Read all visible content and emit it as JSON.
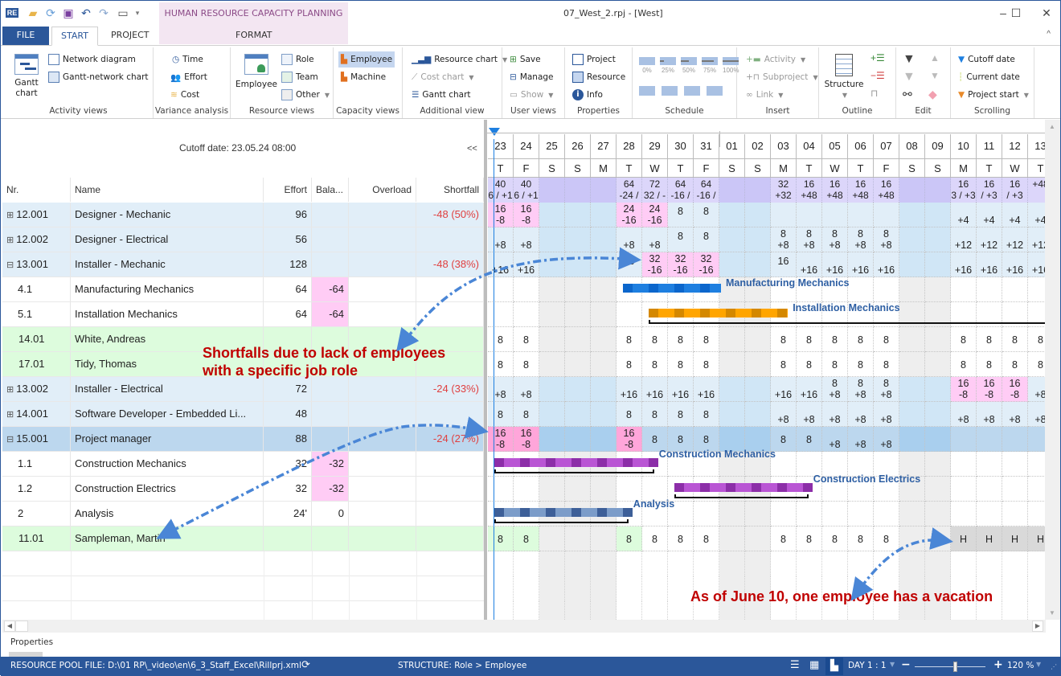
{
  "window": {
    "context_tab_group": "HUMAN RESOURCE CAPACITY PLANNING",
    "doc_title": "07_West_2.rpj - [West]",
    "controls": {
      "minimize": "–",
      "maximize": "☐",
      "close": "✕"
    }
  },
  "quick_access": [
    "app-logo",
    "open-folder",
    "refresh",
    "save",
    "undo",
    "redo",
    "window-layout",
    "customize"
  ],
  "tabs": [
    {
      "label": "FILE"
    },
    {
      "label": "START",
      "active": true
    },
    {
      "label": "PROJECT"
    },
    {
      "label": "FORMAT"
    }
  ],
  "ribbon": {
    "activity_views": {
      "label": "Activity views",
      "gantt": "Gantt chart",
      "gantt_l1": "Gantt",
      "gantt_l2": "chart",
      "network": "Network diagram",
      "gantt_network": "Gantt-network chart"
    },
    "variance": {
      "label": "Variance analysis",
      "time": "Time",
      "effort": "Effort",
      "cost": "Cost"
    },
    "resource_views": {
      "label": "Resource views",
      "employee": "Employee",
      "role": "Role",
      "team": "Team",
      "other": "Other"
    },
    "capacity_views": {
      "label": "Capacity views",
      "employee": "Employee",
      "machine": "Machine"
    },
    "additional": {
      "label": "Additional view",
      "resource_chart": "Resource chart",
      "cost_chart": "Cost chart",
      "gantt_chart": "Gantt chart"
    },
    "user_views": {
      "label": "User views",
      "save": "Save",
      "manage": "Manage",
      "show": "Show"
    },
    "properties": {
      "label": "Properties",
      "project": "Project",
      "resource": "Resource",
      "info": "Info"
    },
    "schedule": {
      "label": "Schedule",
      "pcts": [
        "0%",
        "25%",
        "50%",
        "75%",
        "100%"
      ]
    },
    "insert": {
      "label": "Insert",
      "activity": "Activity",
      "subproject": "Subproject",
      "link": "Link"
    },
    "outline": {
      "label": "Outline",
      "structure": "Structure"
    },
    "edit": {
      "label": "Edit"
    },
    "scrolling": {
      "label": "Scrolling",
      "cutoff": "Cutoff date",
      "current": "Current date",
      "project_start": "Project start"
    }
  },
  "table": {
    "cutoff_text": "Cutoff date: 23.05.24 08:00",
    "collapse_label": "<<",
    "columns": [
      "Nr.",
      "Name",
      "Effort",
      "Bala...",
      "Overload",
      "Shortfall"
    ],
    "rows": [
      {
        "nr": "12.001",
        "expander": "⊞",
        "name": "Designer - Mechanic",
        "effort": "96",
        "balance": "",
        "overload": "",
        "shortfall": "-48 (50%)",
        "type": "role"
      },
      {
        "nr": "12.002",
        "expander": "⊞",
        "name": "Designer - Electrical",
        "effort": "56",
        "balance": "",
        "overload": "",
        "shortfall": "",
        "type": "role"
      },
      {
        "nr": "13.001",
        "expander": "⊟",
        "name": "Installer - Mechanic",
        "effort": "128",
        "balance": "",
        "overload": "",
        "shortfall": "-48 (38%)",
        "type": "role"
      },
      {
        "nr": "4.1",
        "expander": "",
        "name": "Manufacturing Mechanics",
        "effort": "64",
        "balance": "-64",
        "overload": "",
        "shortfall": "",
        "type": "activity"
      },
      {
        "nr": "5.1",
        "expander": "",
        "name": "Installation Mechanics",
        "effort": "64",
        "balance": "-64",
        "overload": "",
        "shortfall": "",
        "type": "activity"
      },
      {
        "nr": "14.01",
        "expander": "",
        "name": "White, Andreas",
        "effort": "",
        "balance": "",
        "overload": "",
        "shortfall": "",
        "type": "employee"
      },
      {
        "nr": "17.01",
        "expander": "",
        "name": "Tidy, Thomas",
        "effort": "",
        "balance": "",
        "overload": "",
        "shortfall": "",
        "type": "employee"
      },
      {
        "nr": "13.002",
        "expander": "⊞",
        "name": "Installer - Electrical",
        "effort": "72",
        "balance": "",
        "overload": "",
        "shortfall": "-24 (33%)",
        "type": "role"
      },
      {
        "nr": "14.001",
        "expander": "⊞",
        "name": "Software Developer - Embedded Li...",
        "effort": "48",
        "balance": "",
        "overload": "",
        "shortfall": "",
        "type": "role"
      },
      {
        "nr": "15.001",
        "expander": "⊟",
        "name": "Project manager",
        "effort": "88",
        "balance": "",
        "overload": "",
        "shortfall": "-24 (27%)",
        "type": "role-selected"
      },
      {
        "nr": "1.1",
        "expander": "",
        "name": "Construction Mechanics",
        "effort": "32",
        "balance": "-32",
        "overload": "",
        "shortfall": "",
        "type": "activity"
      },
      {
        "nr": "1.2",
        "expander": "",
        "name": "Construction Electrics",
        "effort": "32",
        "balance": "-32",
        "overload": "",
        "shortfall": "",
        "type": "activity"
      },
      {
        "nr": "2",
        "expander": "",
        "name": "Analysis",
        "effort": "24'",
        "balance": "0",
        "overload": "",
        "shortfall": "",
        "type": "activity-plain"
      },
      {
        "nr": "11.01",
        "expander": "",
        "name": "Sampleman, Martin",
        "effort": "",
        "balance": "",
        "overload": "",
        "shortfall": "",
        "type": "employee"
      }
    ]
  },
  "timeline": {
    "days": [
      "23",
      "24",
      "25",
      "26",
      "27",
      "28",
      "29",
      "30",
      "31",
      "01",
      "02",
      "03",
      "04",
      "05",
      "06",
      "07",
      "08",
      "09",
      "10",
      "11",
      "12",
      "13"
    ],
    "weekdays": [
      "T",
      "F",
      "S",
      "S",
      "M",
      "T",
      "W",
      "T",
      "F",
      "S",
      "S",
      "M",
      "T",
      "W",
      "T",
      "F",
      "S",
      "S",
      "M",
      "T",
      "W",
      "T"
    ],
    "weekend_idx": [
      2,
      3,
      4,
      9,
      10,
      16,
      17
    ],
    "summary": [
      "40|6 / +1",
      "40|6 / +1",
      "",
      "",
      "",
      "64|-24 /",
      "72|32 / -",
      "64|-16 /",
      "64|-16 /",
      "",
      "",
      "32|+32",
      "16|+48",
      "16|+48",
      "16|+48",
      "16|+48",
      "",
      "",
      "16|3 / +3",
      "16|/ +3",
      "16|/ +3",
      "|+48"
    ],
    "grid": [
      [
        "16|-8",
        "16|-8",
        "",
        "",
        "",
        "24|-16",
        "24|-16",
        "8|",
        "8|",
        "",
        "",
        "",
        "",
        "",
        "",
        "",
        "",
        "",
        "|+4",
        "|+4",
        "|+4",
        "|+4"
      ],
      [
        "|+8",
        "|+8",
        "",
        "",
        "",
        "|+8",
        "|+8",
        "8|",
        "8|",
        "",
        "",
        "8|+8",
        "8|+8",
        "8|+8",
        "8|+8",
        "8|+8",
        "",
        "",
        "|+12",
        "|+12",
        "|+12",
        "|+12"
      ],
      [
        "|+16",
        "|+16",
        "",
        "",
        "",
        "16|",
        "32|-16",
        "32|-16",
        "32|-16",
        "",
        "",
        "16|",
        "|+16",
        "|+16",
        "|+16",
        "|+16",
        "",
        "",
        "|+16",
        "|+16",
        "|+16",
        "|+16"
      ],
      [],
      [],
      [
        "8",
        "8",
        "",
        "",
        "",
        "8",
        "8",
        "8",
        "8",
        "",
        "",
        "8",
        "8",
        "8",
        "8",
        "8",
        "",
        "",
        "8",
        "8",
        "8",
        "8"
      ],
      [
        "8",
        "8",
        "",
        "",
        "",
        "8",
        "8",
        "8",
        "8",
        "",
        "",
        "8",
        "8",
        "8",
        "8",
        "8",
        "",
        "",
        "8",
        "8",
        "8",
        "8"
      ],
      [
        "|+8",
        "|+8",
        "",
        "",
        "",
        "|+16",
        "|+16",
        "|+16",
        "|+16",
        "",
        "",
        "|+16",
        "|+16",
        "8|+8",
        "8|+8",
        "8|+8",
        "",
        "",
        "16|-8",
        "16|-8",
        "16|-8",
        "|+8"
      ],
      [
        "8",
        "8",
        "",
        "",
        "",
        "8",
        "8",
        "8",
        "8",
        "",
        "",
        "|+8",
        "|+8",
        "|+8",
        "|+8",
        "|+8",
        "",
        "",
        "|+8",
        "|+8",
        "|+8",
        "|+8"
      ],
      [
        "16|-8",
        "16|-8",
        "",
        "",
        "",
        "16|-8",
        "8",
        "8",
        "8",
        "",
        "",
        "8",
        "8",
        "|+8",
        "|+8",
        "|+8",
        "",
        "",
        "",
        "",
        "",
        ""
      ],
      [],
      [],
      [],
      [
        "8",
        "8",
        "",
        "",
        "",
        "8",
        "8",
        "8",
        "8",
        "",
        "",
        "8",
        "8",
        "8",
        "8",
        "8",
        "",
        "",
        "H",
        "H",
        "H",
        "H"
      ]
    ],
    "pink_cells": {
      "0": [
        0,
        1,
        5,
        6
      ],
      "2": [
        6,
        7,
        8
      ],
      "7": [
        18,
        19,
        20
      ],
      "9": [
        0,
        1,
        5
      ]
    },
    "bars": [
      {
        "row": 3,
        "label": "Manufacturing Mechanics",
        "color": "#1e7fe0",
        "dark": "#0b66cc",
        "start": 5,
        "end": 9
      },
      {
        "row": 4,
        "label": "Installation Mechanics",
        "color": "#ffa500",
        "dark": "#d48800",
        "start": 6,
        "end": 11.6
      },
      {
        "row": 10,
        "label": "Construction Mechanics",
        "color": "#b955d4",
        "dark": "#8c2ea8",
        "start": 0,
        "end": 6.4
      },
      {
        "row": 11,
        "label": "Construction Electrics",
        "color": "#b955d4",
        "dark": "#8c2ea8",
        "start": 7,
        "end": 12.4
      },
      {
        "row": 12,
        "label": "Analysis",
        "color": "#7b9cc9",
        "dark": "#3d5f98",
        "start": 0,
        "end": 5.4
      }
    ]
  },
  "annotations": {
    "shortfall_l1": "Shortfalls due to lack of employees",
    "shortfall_l2": "with a specific job role",
    "vacation": "As of June 10, one employee has a vacation"
  },
  "bottom": {
    "properties_tab": "Properties"
  },
  "status": {
    "pool_file": "RESOURCE POOL FILE: D:\\01 RP\\_video\\en\\6_3_Staff_Excel\\Rillprj.xml",
    "structure": "STRUCTURE: Role > Employee",
    "scale": "DAY 1 : 1",
    "zoom": "120 %",
    "zoom_value_pct": 120
  },
  "colors": {
    "accent": "#2b579a",
    "role_row": "#e1eef8",
    "selected_row": "#bcd7ee",
    "employee_row": "#ddfcdd",
    "pink": "#ffccf5",
    "summary": "#dcd6fa",
    "annotation": "#c00000"
  }
}
